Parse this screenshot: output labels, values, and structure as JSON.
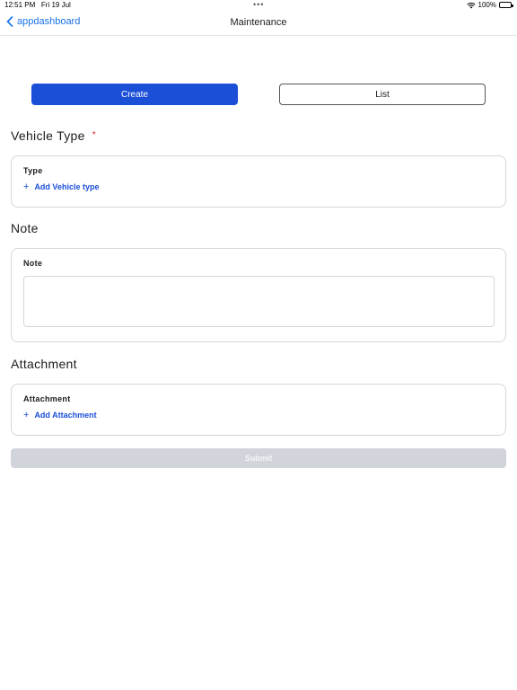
{
  "status_bar": {
    "time": "12:51 PM",
    "date": "Fri 19 Jul",
    "battery": "100%"
  },
  "nav": {
    "back_label": "appdashboard",
    "title": "Maintenance"
  },
  "segments": {
    "create_label": "Create",
    "list_label": "List",
    "active": "Create"
  },
  "vehicle_type": {
    "title": "Vehicle Type",
    "required_mark": "*",
    "field_label": "Type",
    "add_label": "Add Vehicle type"
  },
  "note": {
    "title": "Note",
    "field_label": "Note",
    "value": ""
  },
  "attachment": {
    "title": "Attachment",
    "field_label": "Attachment",
    "add_label": "Add Attachment"
  },
  "submit_label": "Submit",
  "colors": {
    "accent": "#1c4fd8",
    "link": "#1a73e8",
    "required": "#e02424",
    "disabled": "#d1d5db"
  }
}
